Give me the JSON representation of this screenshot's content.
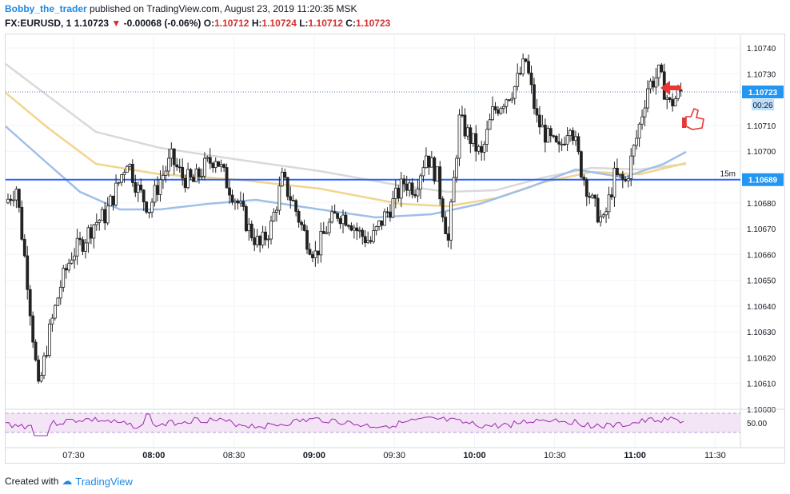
{
  "header": {
    "author": "Bobby_the_trader",
    "published": "published on TradingView.com, August 23, 2019 11:20:35 MSK",
    "symbol": "FX:EURUSD, 1",
    "last": "1.10723",
    "change_arrow": "▼",
    "change": "-0.00068 (-0.06%)",
    "o_label": "O:",
    "o": "1.10712",
    "h_label": "H:",
    "h": "1.10724",
    "l_label": "L:",
    "l": "1.10712",
    "c_label": "C:",
    "c": "1.10723"
  },
  "price_axis": {
    "ticks": [
      "1.10740",
      "1.10730",
      "1.10710",
      "1.10700",
      "1.10680",
      "1.10670",
      "1.10660",
      "1.10650",
      "1.10640",
      "1.10630",
      "1.10620",
      "1.10610",
      "1.10600"
    ],
    "last_price_label": "1.10723",
    "countdown_label": "00:26",
    "level_label": "1.10689",
    "level_tf": "15m"
  },
  "time_axis": {
    "ticks": [
      "07:30",
      "08:00",
      "08:30",
      "09:00",
      "09:30",
      "10:00",
      "10:30",
      "11:00",
      "11:30"
    ]
  },
  "rsi": {
    "label": "50.00"
  },
  "footer": {
    "created_with": "Created with",
    "brand": "TradingView"
  },
  "colors": {
    "level_line": "#2962ff",
    "ma_fast": "#9fbfe8",
    "ma_mid": "#f2d58c",
    "ma_slow": "#d9d9d9",
    "rsi_line": "#9c27b0",
    "rsi_band": "#f3e5f5",
    "price_label": "#2196f3",
    "annotation": "#e53935"
  },
  "chart_data": {
    "type": "candlestick",
    "x": [
      "07:30",
      "08:00",
      "08:30",
      "09:00",
      "09:30",
      "10:00",
      "10:30",
      "11:00",
      "11:30"
    ],
    "ylim": [
      1.106,
      1.10745
    ],
    "level": 1.10689,
    "last_price": 1.10723,
    "close_path": [
      1.1068,
      1.10686,
      1.1065,
      1.10607,
      1.1063,
      1.10648,
      1.1066,
      1.10665,
      1.10672,
      1.10675,
      1.10685,
      1.10697,
      1.10685,
      1.10678,
      1.10689,
      1.10697,
      1.1069,
      1.10688,
      1.10694,
      1.10698,
      1.10688,
      1.1068,
      1.1067,
      1.10663,
      1.10671,
      1.10689,
      1.1068,
      1.10668,
      1.1066,
      1.1067,
      1.10676,
      1.10674,
      1.10668,
      1.10665,
      1.10673,
      1.1068,
      1.10688,
      1.10686,
      1.10699,
      1.1069,
      1.10665,
      1.10712,
      1.10705,
      1.10698,
      1.10715,
      1.1072,
      1.10725,
      1.10735,
      1.10712,
      1.10705,
      1.107,
      1.10712,
      1.10693,
      1.1068,
      1.10672,
      1.1069,
      1.10688,
      1.10705,
      1.10725,
      1.1073,
      1.10718,
      1.10723
    ],
    "rsi_level": 50
  }
}
